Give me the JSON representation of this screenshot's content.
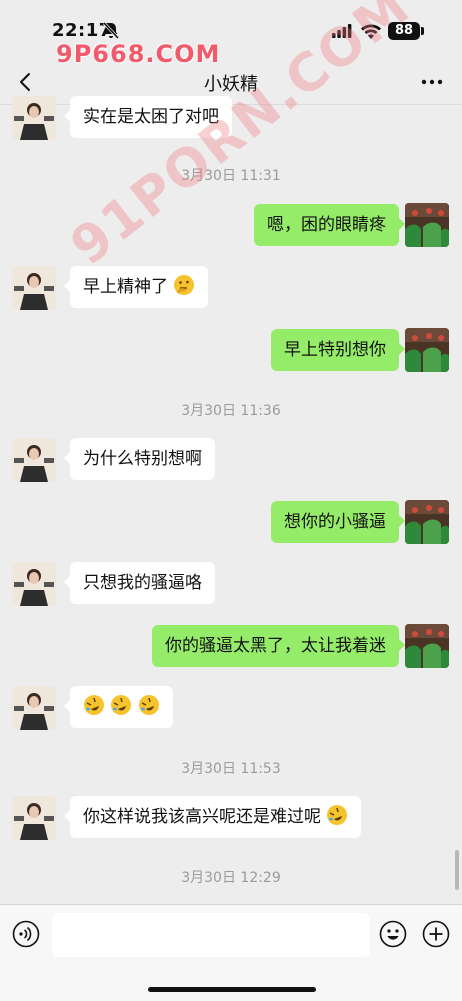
{
  "status_bar": {
    "time": "22:17",
    "battery": "88"
  },
  "watermarks": {
    "top": "9P668.COM",
    "diagonal": "91PORN.COM"
  },
  "header": {
    "title": "小妖精"
  },
  "messages": [
    {
      "side": "in",
      "text": "实在是太困了对吧"
    },
    {
      "timestamp": "3月30日 11:31"
    },
    {
      "side": "out",
      "text": "嗯，困的眼睛疼"
    },
    {
      "side": "in",
      "text": "早上精神了",
      "emoji": "thinking-face"
    },
    {
      "side": "out",
      "text": "早上特别想你"
    },
    {
      "timestamp": "3月30日 11:36"
    },
    {
      "side": "in",
      "text": "为什么特别想啊"
    },
    {
      "side": "out",
      "text": "想你的小骚逼"
    },
    {
      "side": "in",
      "text": "只想我的骚逼咯"
    },
    {
      "side": "out",
      "text": "你的骚逼太黑了，太让我着迷"
    },
    {
      "side": "in",
      "text": "",
      "emoji": "rolling-laughing-face x3"
    },
    {
      "timestamp": "3月30日 11:53"
    },
    {
      "side": "in",
      "text": "你这样说我该高兴呢还是难过呢",
      "emoji": "rolling-laughing-face"
    },
    {
      "timestamp": "3月30日 12:29"
    }
  ],
  "input": {
    "placeholder": ""
  },
  "colors": {
    "background": "#ededed",
    "incoming_bubble": "#ffffff",
    "outgoing_bubble": "#95ec69",
    "timestamp": "#9b9b9b",
    "watermark": "#f15a6a"
  }
}
